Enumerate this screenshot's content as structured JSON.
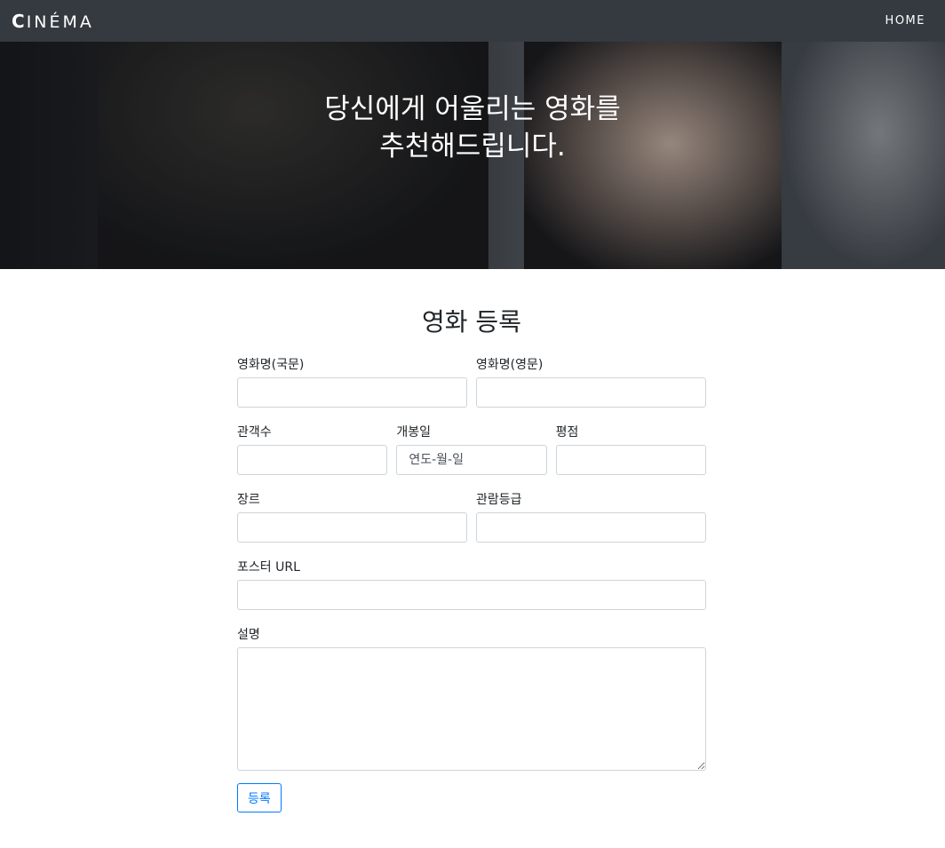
{
  "navbar": {
    "brand_first": "C",
    "brand_rest": "INÉMA",
    "home_label": "HOME"
  },
  "hero": {
    "line1": "당신에게 어울리는 영화를",
    "line2": "추천해드립니다."
  },
  "form": {
    "title": "영화 등록",
    "title_kr_label": "영화명(국문)",
    "title_en_label": "영화명(영문)",
    "audience_label": "관객수",
    "release_label": "개봉일",
    "release_placeholder": "연도-월-일",
    "rating_label": "평점",
    "genre_label": "장르",
    "grade_label": "관람등급",
    "poster_label": "포스터 URL",
    "description_label": "설명",
    "submit_label": "등록"
  },
  "colors": {
    "navbar_bg": "#343a40",
    "accent": "#007bff"
  }
}
